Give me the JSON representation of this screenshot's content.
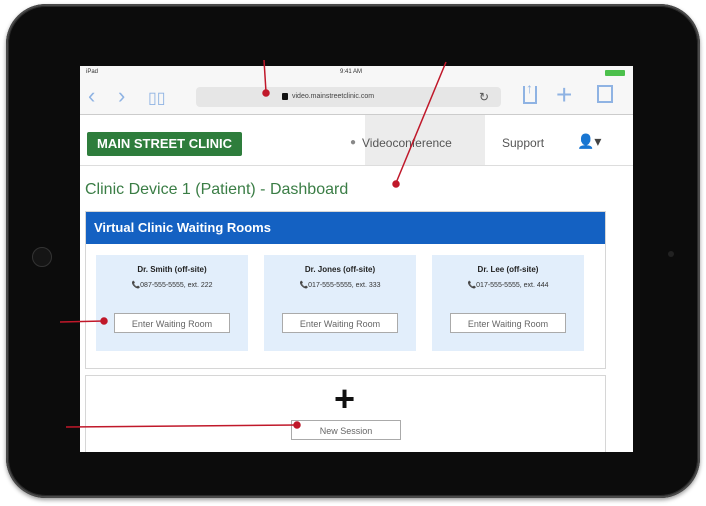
{
  "status_bar": {
    "device": "iPad",
    "time": "9:41 AM"
  },
  "browser": {
    "url": "video.mainstreetclinic.com",
    "icons": [
      "back-icon",
      "forward-icon",
      "bookmarks-icon",
      "lock-icon",
      "reload-icon",
      "share-icon",
      "plus-icon",
      "tabs-icon"
    ]
  },
  "app_nav": {
    "brand": "MAIN STREET CLINIC",
    "items": [
      "Videoconference",
      "Support"
    ],
    "active": "Videoconference"
  },
  "page": {
    "title": "Clinic Device 1 (Patient) - Dashboard"
  },
  "waiting_rooms": {
    "header": "Virtual Clinic Waiting Rooms",
    "cards": [
      {
        "name": "Dr. Smith (off-site)",
        "phone": "087-555-5555, ext. 222",
        "button": "Enter Waiting Room"
      },
      {
        "name": "Dr. Jones (off-site)",
        "phone": "017-555-5555, ext. 333",
        "button": "Enter Waiting Room"
      },
      {
        "name": "Dr. Lee (off-site)",
        "phone": "017-555-5555, ext. 444",
        "button": "Enter Waiting Room"
      }
    ]
  },
  "new_session": {
    "button": "New Session"
  },
  "colors": {
    "brand_green": "#2e7d3c",
    "header_blue": "#1461c2",
    "card_blue": "#e2eefb",
    "callout_red": "#c0182a"
  }
}
